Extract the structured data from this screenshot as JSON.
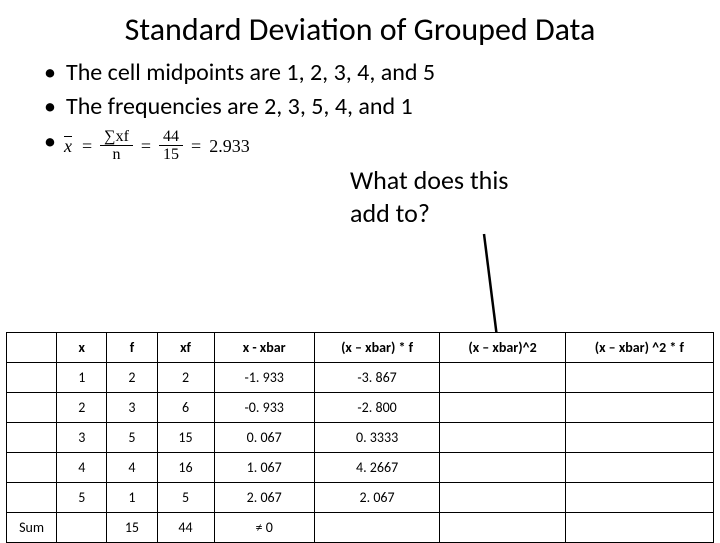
{
  "title": "Standard Deviation of Grouped Data",
  "bullets": {
    "b1": "The cell midpoints are 1, 2, 3, 4, and 5",
    "b2": "The frequencies are 2, 3, 5, 4, and 1"
  },
  "formula": {
    "num1": "∑xf",
    "den1": "n",
    "num2": "44",
    "den2": "15",
    "result": "2.933"
  },
  "side_question": {
    "l1": "What does this",
    "l2": "add to?"
  },
  "table": {
    "headers": {
      "h0": "",
      "h1": "x",
      "h2": "f",
      "h3": "xf",
      "h4": "x - xbar",
      "h5": "(x – xbar) * f",
      "h6": "(x – xbar)^2",
      "h7": "(x – xbar) ^2 * f"
    },
    "rows": [
      {
        "c0": "",
        "c1": "1",
        "c2": "2",
        "c3": "2",
        "c4": "-1. 933",
        "c5": "-3. 867",
        "c6": "",
        "c7": ""
      },
      {
        "c0": "",
        "c1": "2",
        "c2": "3",
        "c3": "6",
        "c4": "-0. 933",
        "c5": "-2. 800",
        "c6": "",
        "c7": ""
      },
      {
        "c0": "",
        "c1": "3",
        "c2": "5",
        "c3": "15",
        "c4": "0. 067",
        "c5": "0. 3333",
        "c6": "",
        "c7": ""
      },
      {
        "c0": "",
        "c1": "4",
        "c2": "4",
        "c3": "16",
        "c4": "1. 067",
        "c5": "4. 2667",
        "c6": "",
        "c7": ""
      },
      {
        "c0": "",
        "c1": "5",
        "c2": "1",
        "c3": "5",
        "c4": "2. 067",
        "c5": "2. 067",
        "c6": "",
        "c7": ""
      }
    ],
    "sum": {
      "c0": "Sum",
      "c1": "",
      "c2": "15",
      "c3": "44",
      "c4": "≠ 0",
      "c5": "",
      "c6": "",
      "c7": ""
    }
  },
  "chart_data": {
    "type": "table",
    "title": "Standard Deviation of Grouped Data",
    "columns": [
      "x",
      "f",
      "xf",
      "x - xbar",
      "(x – xbar) * f",
      "(x – xbar)^2",
      "(x – xbar)^2 * f"
    ],
    "rows": [
      [
        1,
        2,
        2,
        -1.933,
        -3.867,
        null,
        null
      ],
      [
        2,
        3,
        6,
        -0.933,
        -2.8,
        null,
        null
      ],
      [
        3,
        5,
        15,
        0.067,
        0.3333,
        null,
        null
      ],
      [
        4,
        4,
        16,
        1.067,
        4.2667,
        null,
        null
      ],
      [
        5,
        1,
        5,
        2.067,
        2.067,
        null,
        null
      ]
    ],
    "sum_row": [
      null,
      15,
      44,
      "≠ 0",
      null,
      null,
      null
    ],
    "xbar": 2.933
  }
}
